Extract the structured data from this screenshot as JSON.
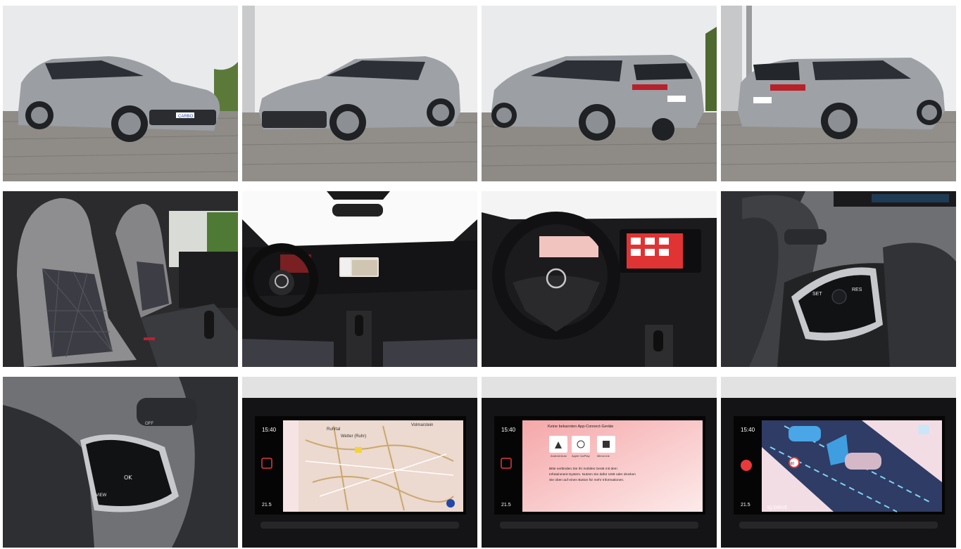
{
  "gallery": {
    "tiles": [
      {
        "id": "front-left"
      },
      {
        "id": "front-right"
      },
      {
        "id": "rear-left"
      },
      {
        "id": "rear-right"
      },
      {
        "id": "front-seats"
      },
      {
        "id": "dashboard-wide"
      },
      {
        "id": "cockpit-close"
      },
      {
        "id": "steering-right-controls"
      },
      {
        "id": "steering-left-controls"
      },
      {
        "id": "infotainment-navigation"
      },
      {
        "id": "infotainment-app-connect"
      },
      {
        "id": "infotainment-iq-drive"
      }
    ]
  },
  "plates": {
    "plate_text": "CARBO"
  },
  "wheel_buttons_right": {
    "set": "SET",
    "res": "RES"
  },
  "wheel_buttons_left": {
    "ok": "OK",
    "view": "VIEW",
    "off": "OFF"
  },
  "screen_status": {
    "time": "15:40",
    "temp": "21.5"
  },
  "nav_screen": {
    "place_1": "Ruhrtal",
    "place_2": "Wetter (Ruhr)",
    "place_3": "Volmarstein"
  },
  "app_connect": {
    "heading": "Keine bekannten App-Connect-Geräte",
    "apps": [
      "Android Auto",
      "Apple CarPlay",
      "MirrorLink"
    ],
    "body_line_1": "Bitte verbinden Sie Ihr mobiles Gerät mit dem",
    "body_line_2": "Infotainment-System. Nutzen Sie dafür USB oder drücken",
    "body_line_3": "Sie oben auf einen Button für mehr Informationen."
  },
  "iq_drive": {
    "label": "IQ.DRIVE",
    "speed_limit": "60"
  }
}
